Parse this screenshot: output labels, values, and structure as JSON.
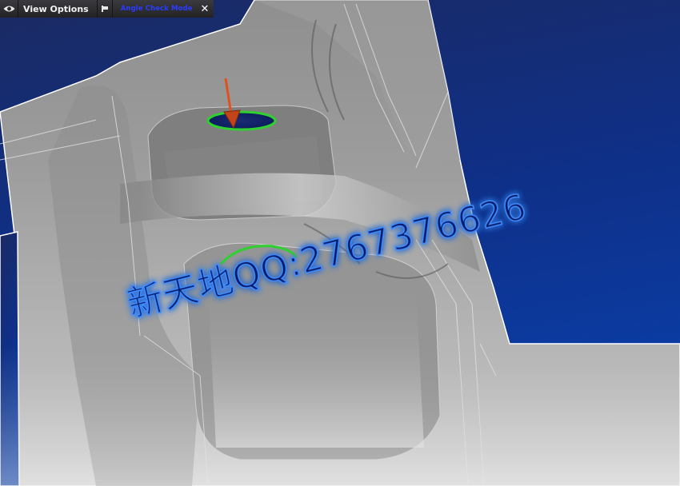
{
  "toolbar": {
    "view_options_label": "View Options",
    "angle_check_mode_label": "Angle Check Mode",
    "close_symbol": "✕",
    "icons": {
      "view": "eye-icon",
      "pin": "pin-icon",
      "close": "close-icon"
    }
  },
  "watermark": {
    "text": "新天地QQ:2767376626",
    "color": "#0d1d6a",
    "glow": "#3d8cff"
  },
  "colors": {
    "background_top": "#1b2a62",
    "background_bottom": "#083a9e",
    "part_surface": "#9a9a9a",
    "hole_rim": "#2ed12e",
    "arrow": "#e0521d"
  }
}
